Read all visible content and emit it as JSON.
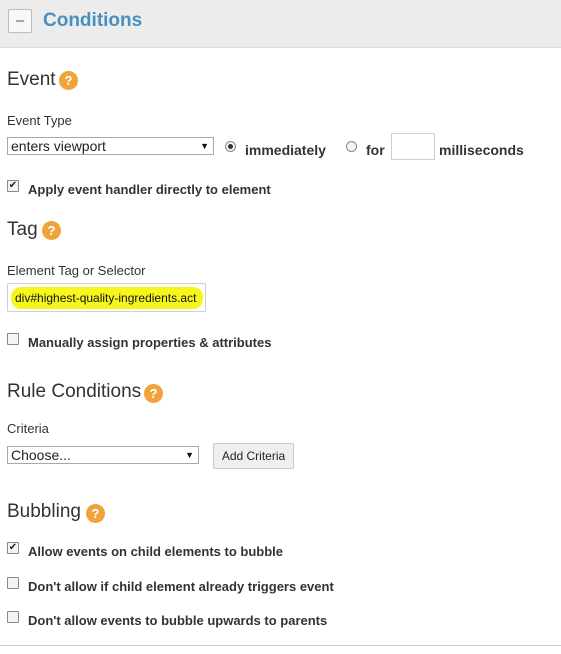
{
  "header": {
    "collapse_label": "–",
    "title": "Conditions"
  },
  "event": {
    "title": "Event",
    "help_glyph": "?",
    "type_label": "Event Type",
    "type_value": "enters viewport",
    "dropdown_glyph": "▼",
    "radio_immediately": "immediately",
    "radio_immediately_selected": true,
    "radio_for": "for",
    "for_value": "",
    "milliseconds_label": "milliseconds",
    "apply_handler_label": "Apply event handler directly to element",
    "apply_handler_checked": true
  },
  "tag": {
    "title": "Tag",
    "help_glyph": "?",
    "selector_label": "Element Tag or Selector",
    "selector_value": "div#highest-quality-ingredients.act",
    "highlight_color": "#f6f61c",
    "manual_assign_label": "Manually assign properties & attributes",
    "manual_assign_checked": false
  },
  "rule_conditions": {
    "title": "Rule Conditions",
    "help_glyph": "?",
    "criteria_label": "Criteria",
    "criteria_value": "Choose...",
    "dropdown_glyph": "▼",
    "add_button": "Add Criteria"
  },
  "bubbling": {
    "title": "Bubbling",
    "help_glyph": "?",
    "check_mark": "✔",
    "options": [
      {
        "label": "Allow events on child elements to bubble",
        "checked": true
      },
      {
        "label": "Don't allow if child element already triggers event",
        "checked": false
      },
      {
        "label": "Don't allow events to bubble upwards to parents",
        "checked": false
      }
    ]
  },
  "colors": {
    "accent": "#4a8fc0",
    "help": "#f0a33b",
    "header_bg": "#ececec"
  }
}
